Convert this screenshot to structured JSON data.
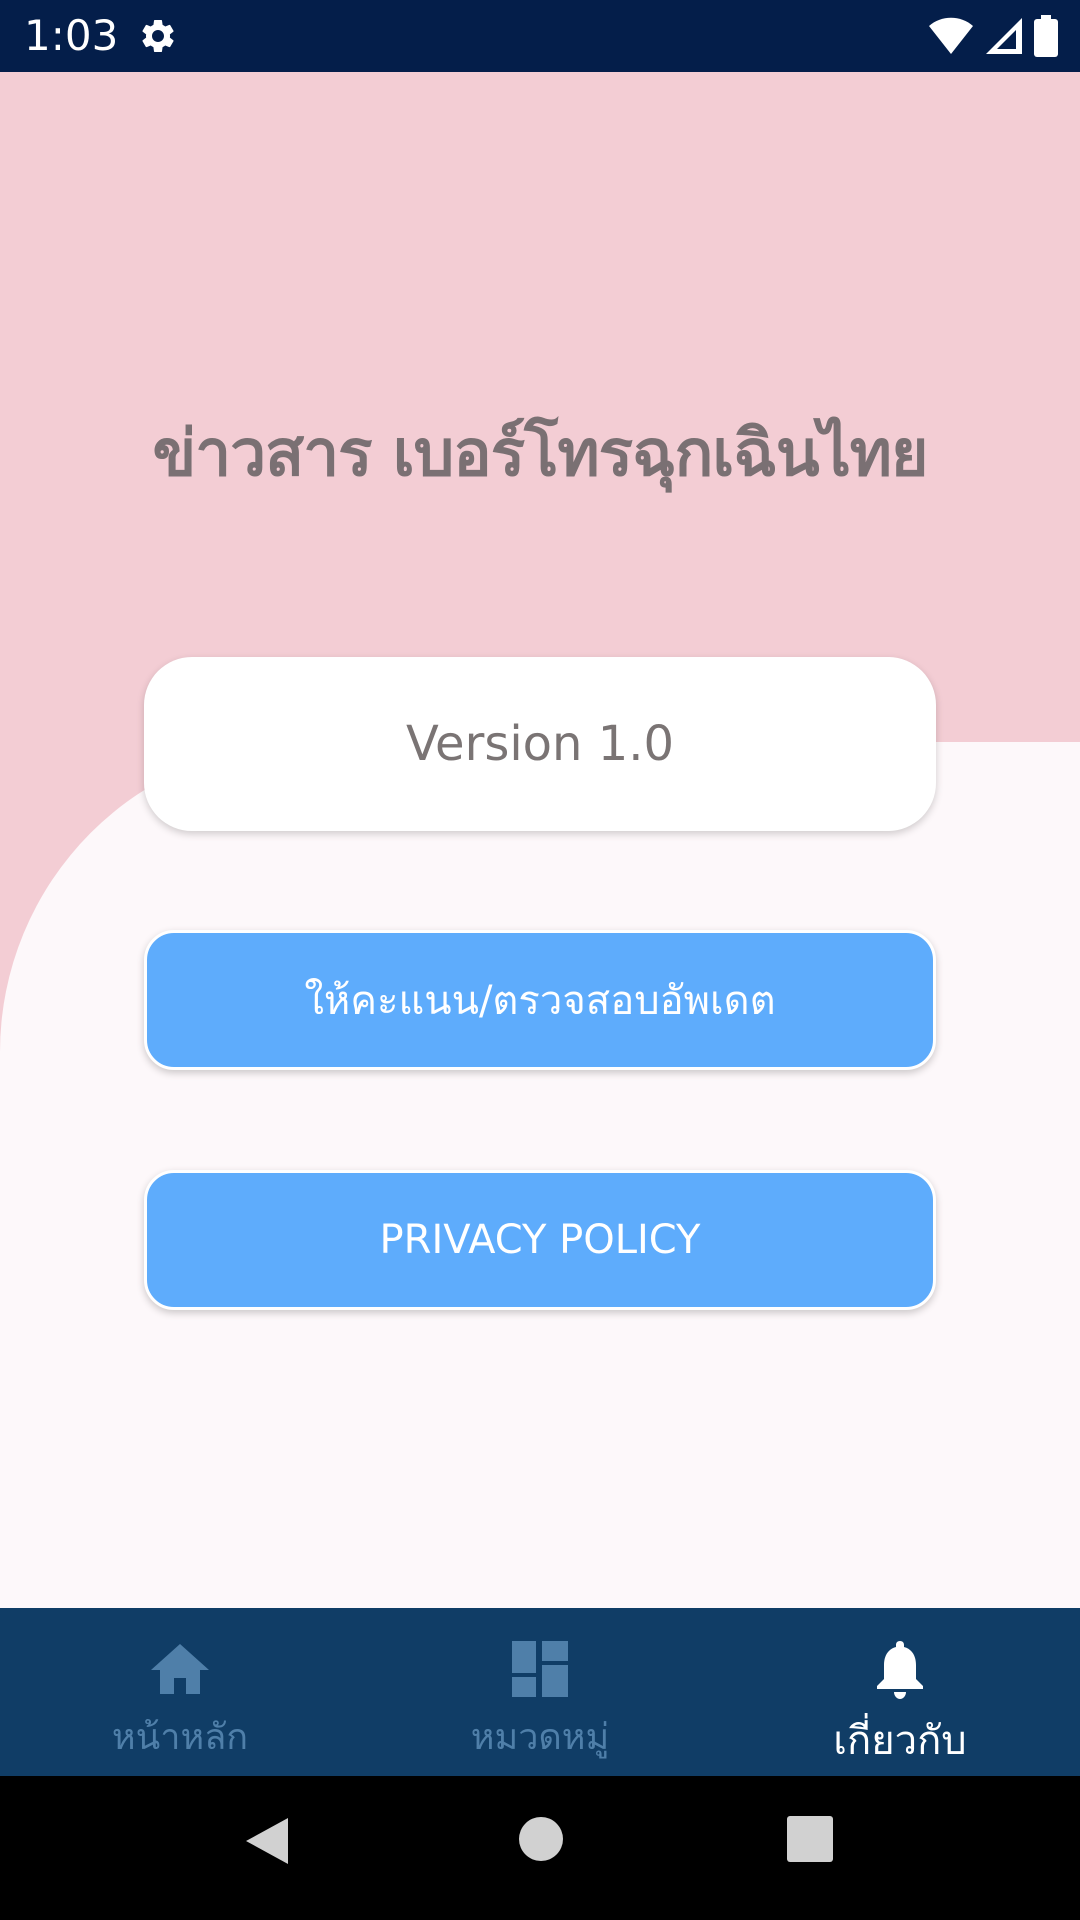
{
  "status_bar": {
    "time": "1:03",
    "settings_icon": "gear-icon",
    "wifi_icon": "wifi-icon",
    "signal_icon": "cell-signal-icon",
    "battery_icon": "battery-icon"
  },
  "main": {
    "title": "ข่าวสาร เบอร์โทรฉุกเฉินไทย",
    "version_label": "Version 1.0",
    "rate_button_label": "ให้คะแนน/ตรวจสอบอัพเดต",
    "privacy_button_label": "PRIVACY POLICY"
  },
  "bottom_nav": {
    "items": [
      {
        "label": "หน้าหลัก",
        "icon": "home-icon",
        "active": false
      },
      {
        "label": "หมวดหมู่",
        "icon": "dashboard-icon",
        "active": false
      },
      {
        "label": "เกี่ยวกับ",
        "icon": "bell-icon",
        "active": true
      }
    ]
  },
  "system_nav": {
    "back_icon": "back-triangle-icon",
    "home_icon": "home-circle-icon",
    "recents_icon": "recents-square-icon"
  },
  "colors": {
    "status_bar": "#041e4a",
    "pink_background": "#f3cdd4",
    "content_background": "#fdf8fa",
    "button_blue": "#5eacfc",
    "bottom_nav": "#103d66",
    "nav_inactive": "#4f7fa9",
    "nav_active": "#ffffff",
    "title_text": "#7a7073"
  }
}
